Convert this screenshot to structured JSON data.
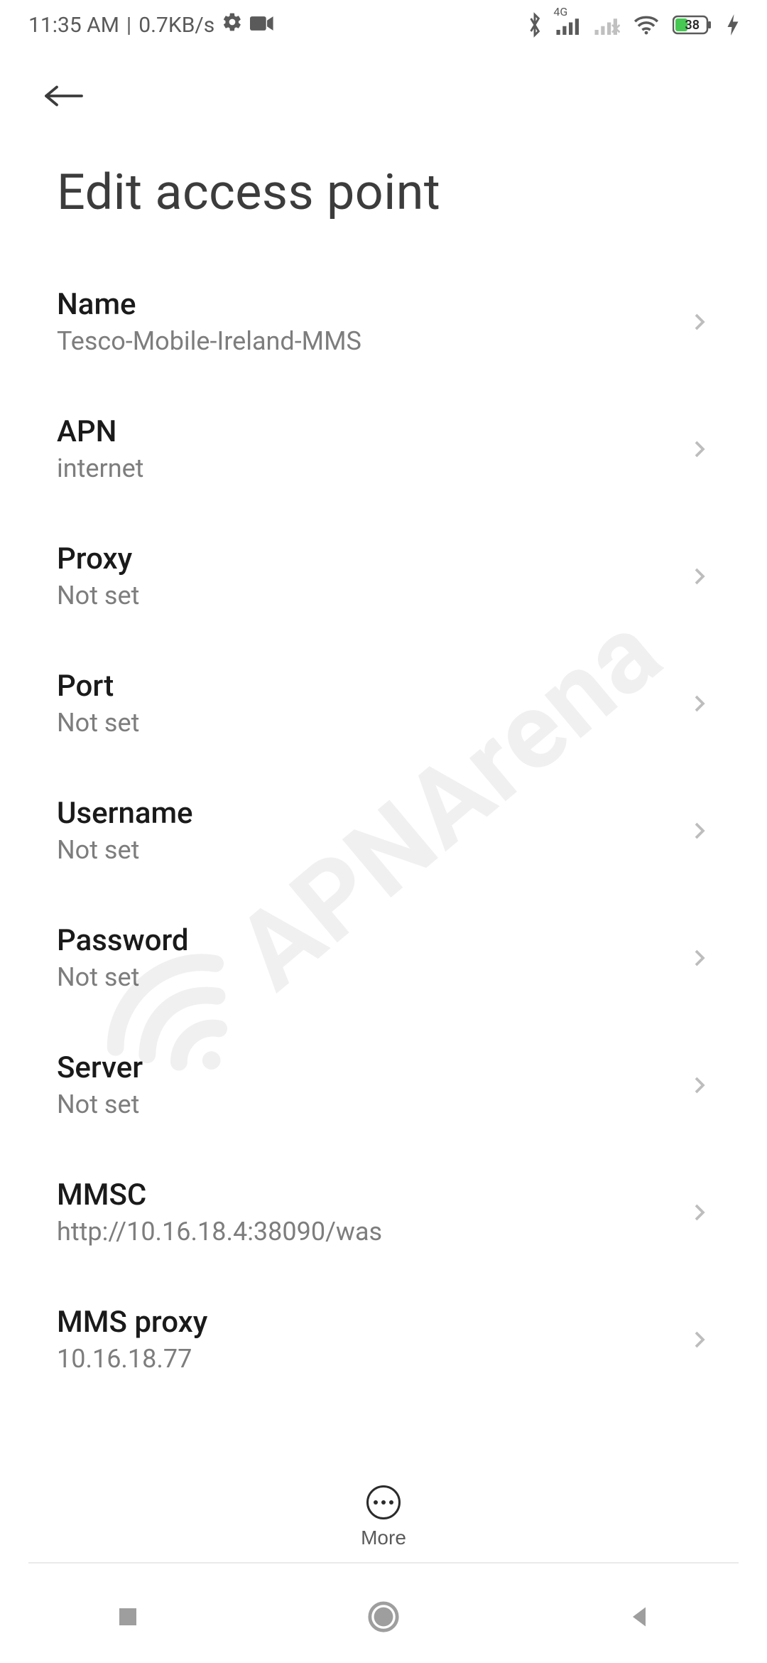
{
  "status_bar": {
    "time": "11:35 AM",
    "divider": "|",
    "data_rate": "0.7KB/s",
    "battery_pct": "38",
    "network_label": "4G"
  },
  "page": {
    "title": "Edit access point"
  },
  "fields": [
    {
      "label": "Name",
      "value": "Tesco-Mobile-Ireland-MMS"
    },
    {
      "label": "APN",
      "value": "internet"
    },
    {
      "label": "Proxy",
      "value": "Not set"
    },
    {
      "label": "Port",
      "value": "Not set"
    },
    {
      "label": "Username",
      "value": "Not set"
    },
    {
      "label": "Password",
      "value": "Not set"
    },
    {
      "label": "Server",
      "value": "Not set"
    },
    {
      "label": "MMSC",
      "value": "http://10.16.18.4:38090/was"
    },
    {
      "label": "MMS proxy",
      "value": "10.16.18.77"
    }
  ],
  "actions": {
    "more_label": "More"
  },
  "watermark": {
    "text": "APNArena"
  }
}
